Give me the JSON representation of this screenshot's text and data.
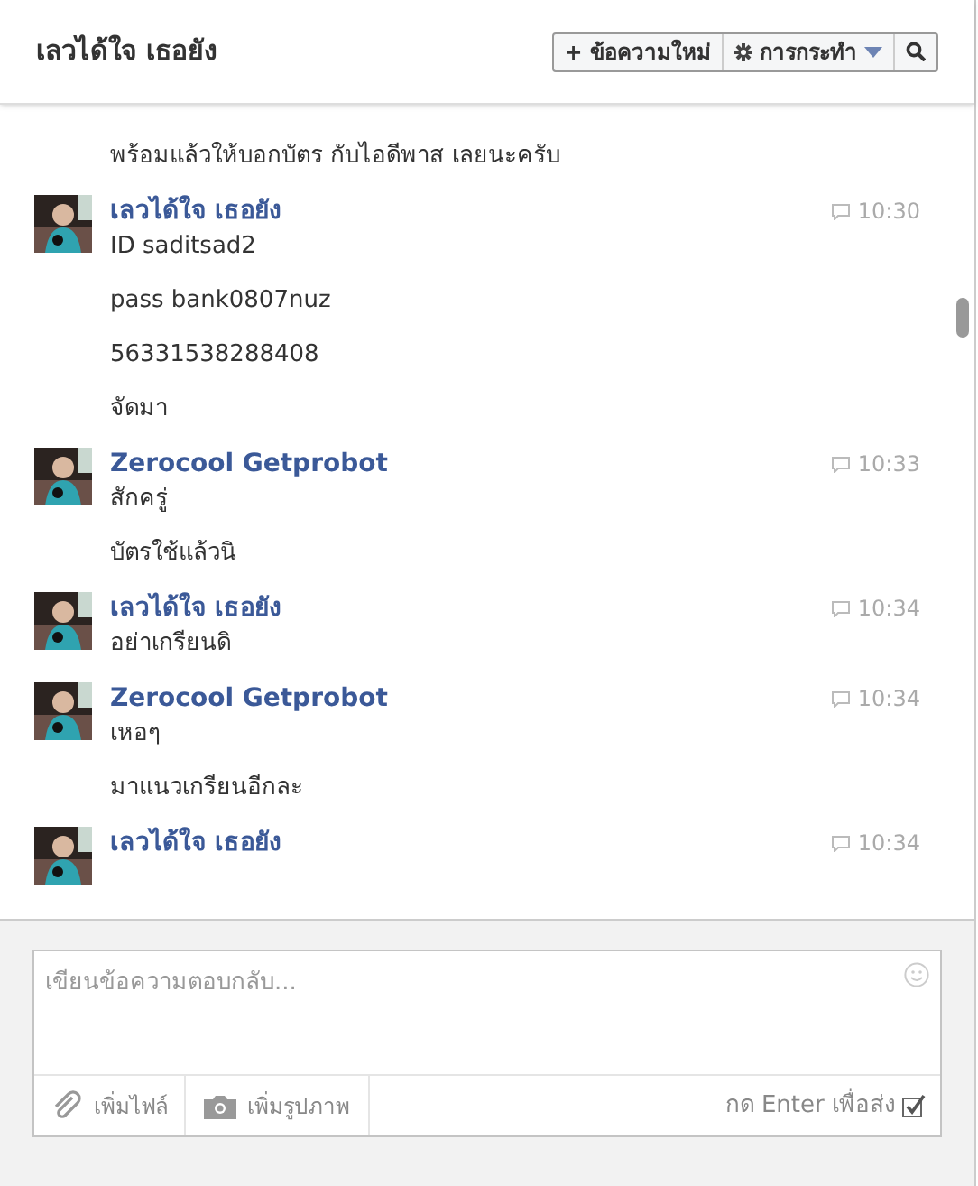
{
  "header": {
    "title": "เลวได้ใจ เธอยัง",
    "new_message_button": "+ ข้อความใหม่",
    "actions_button": "การกระทำ"
  },
  "messages": [
    {
      "lines": [
        "พร้อมแล้วให้บอกบัตร กับไอดีพาส เลยนะครับ"
      ]
    },
    {
      "sender": "เลวได้ใจ เธอยัง",
      "time": "10:30",
      "avatar": {
        "kind": "picture"
      },
      "lines": [
        "ID saditsad2",
        "pass bank0807nuz",
        "56331538288408",
        "จัดมา"
      ]
    },
    {
      "sender": "Zerocool Getprobot",
      "time": "10:33",
      "avatar": {
        "kind": "picture"
      },
      "lines": [
        "สักครู่",
        "บัตรใช้แล้วนิ"
      ]
    },
    {
      "sender": "เลวได้ใจ เธอยัง",
      "time": "10:34",
      "avatar": {
        "kind": "picture"
      },
      "lines": [
        "อย่าเกรียนดิ"
      ]
    },
    {
      "sender": "Zerocool Getprobot",
      "time": "10:34",
      "avatar": {
        "kind": "picture"
      },
      "lines": [
        "เหอๆ",
        "มาแนวเกรียนอีกละ"
      ]
    },
    {
      "sender": "เลวได้ใจ เธอยัง",
      "time": "10:34",
      "avatar": {
        "kind": "picture"
      }
    }
  ],
  "composer": {
    "placeholder": "เขียนข้อความตอบกลับ...",
    "add_file": "เพิ่มไฟล์",
    "add_photo": "เพิ่มรูปภาพ",
    "enter_to_send": {
      "label": "กด Enter เพื่อส่ง",
      "checked": true
    }
  }
}
